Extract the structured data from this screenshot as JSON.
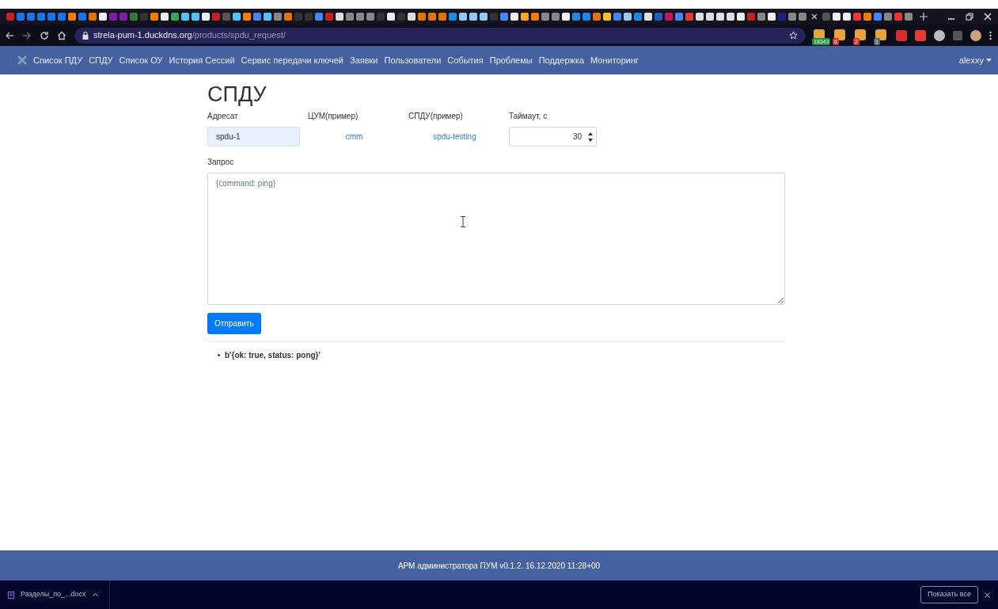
{
  "browser": {
    "url_host": "strela-pum-1.duckdns.org",
    "url_path": "/products/spdu_request/",
    "extension_badges": [
      {
        "text": "18343",
        "color": "#1e8e3e"
      },
      {
        "text": "6",
        "color": "#d93025"
      },
      {
        "text": "2",
        "color": "#d93025"
      },
      {
        "text": "1",
        "color": "#5f6368"
      }
    ]
  },
  "navbar": {
    "items": [
      {
        "label": "Список ПДУ"
      },
      {
        "label": "СПДУ"
      },
      {
        "label": "Список ОУ"
      },
      {
        "label": "История Сессий"
      },
      {
        "label": "Сервис передачи ключей"
      },
      {
        "label": "Заявки"
      },
      {
        "label": "Пользователи"
      },
      {
        "label": "События"
      },
      {
        "label": "Проблемы"
      },
      {
        "label": "Поддержка"
      },
      {
        "label": "Мониторинг"
      }
    ],
    "user": "alexxy"
  },
  "page": {
    "title": "СПДУ",
    "fields": [
      {
        "kind": "input",
        "label": "Адресат",
        "value": "spdu-1"
      },
      {
        "kind": "link",
        "label": "ЦУМ(пример)",
        "value": "cmm"
      },
      {
        "kind": "link",
        "label": "СПДУ(пример)",
        "value": "spdu-testing"
      },
      {
        "kind": "number",
        "label": "Таймаут, с",
        "value": "30"
      }
    ],
    "request_label": "Запрос",
    "request_placeholder": "{command: ping}",
    "submit": "Отправить",
    "results": [
      "b'{ok: true, status: pong}'"
    ]
  },
  "footer": "АРМ администратора ПУМ v0.1.2. 16.12.2020 11:28+00",
  "downloads": {
    "file": "Разделы_по_...docx",
    "show_all": "Показать все"
  }
}
